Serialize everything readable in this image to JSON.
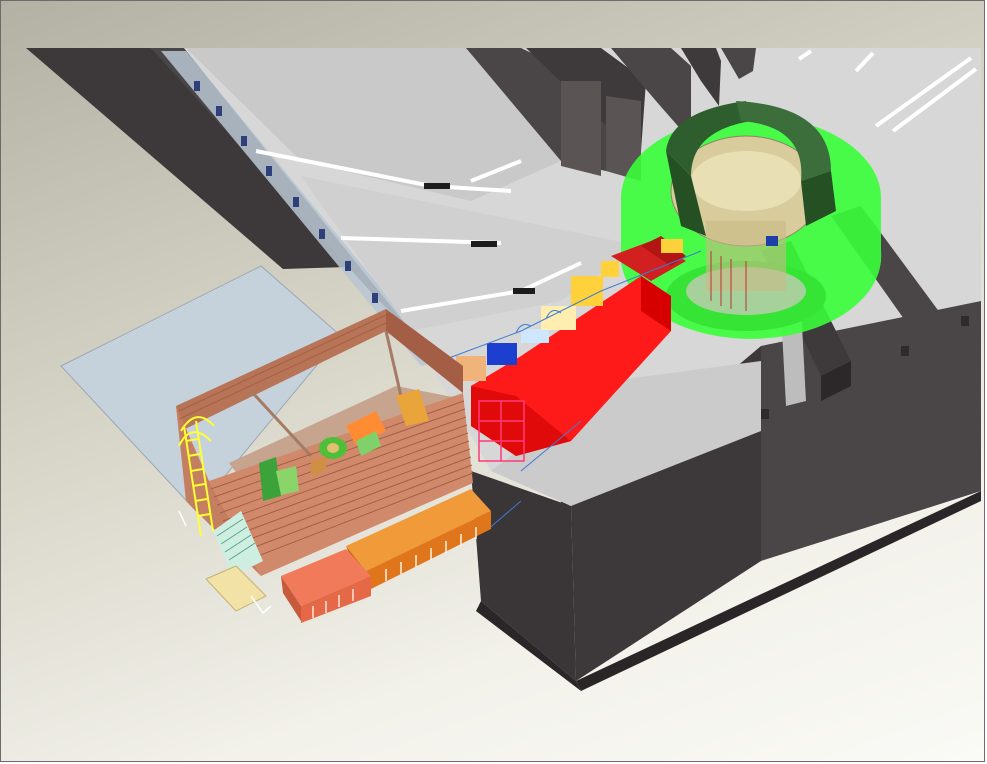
{
  "viewport": {
    "background_top": "#b3b1a3",
    "background_bottom": "#fafaf6"
  },
  "colors": {
    "wall_top": "#3f3a3b",
    "wall_side": "#2e2a2b",
    "floor": "#d9d9d9",
    "platform": "#bcc8d2",
    "hutch_wood": "#c98a68",
    "hutch_dark": "#a66a4c",
    "shielding_red": "#ff1a1a",
    "ring_green": "#2e5e2e",
    "sector_green": "#39ff39",
    "ladder_yellow": "#ffff33",
    "cabin_orange": "#e0761c",
    "cabin_salmon": "#f07a5a"
  }
}
